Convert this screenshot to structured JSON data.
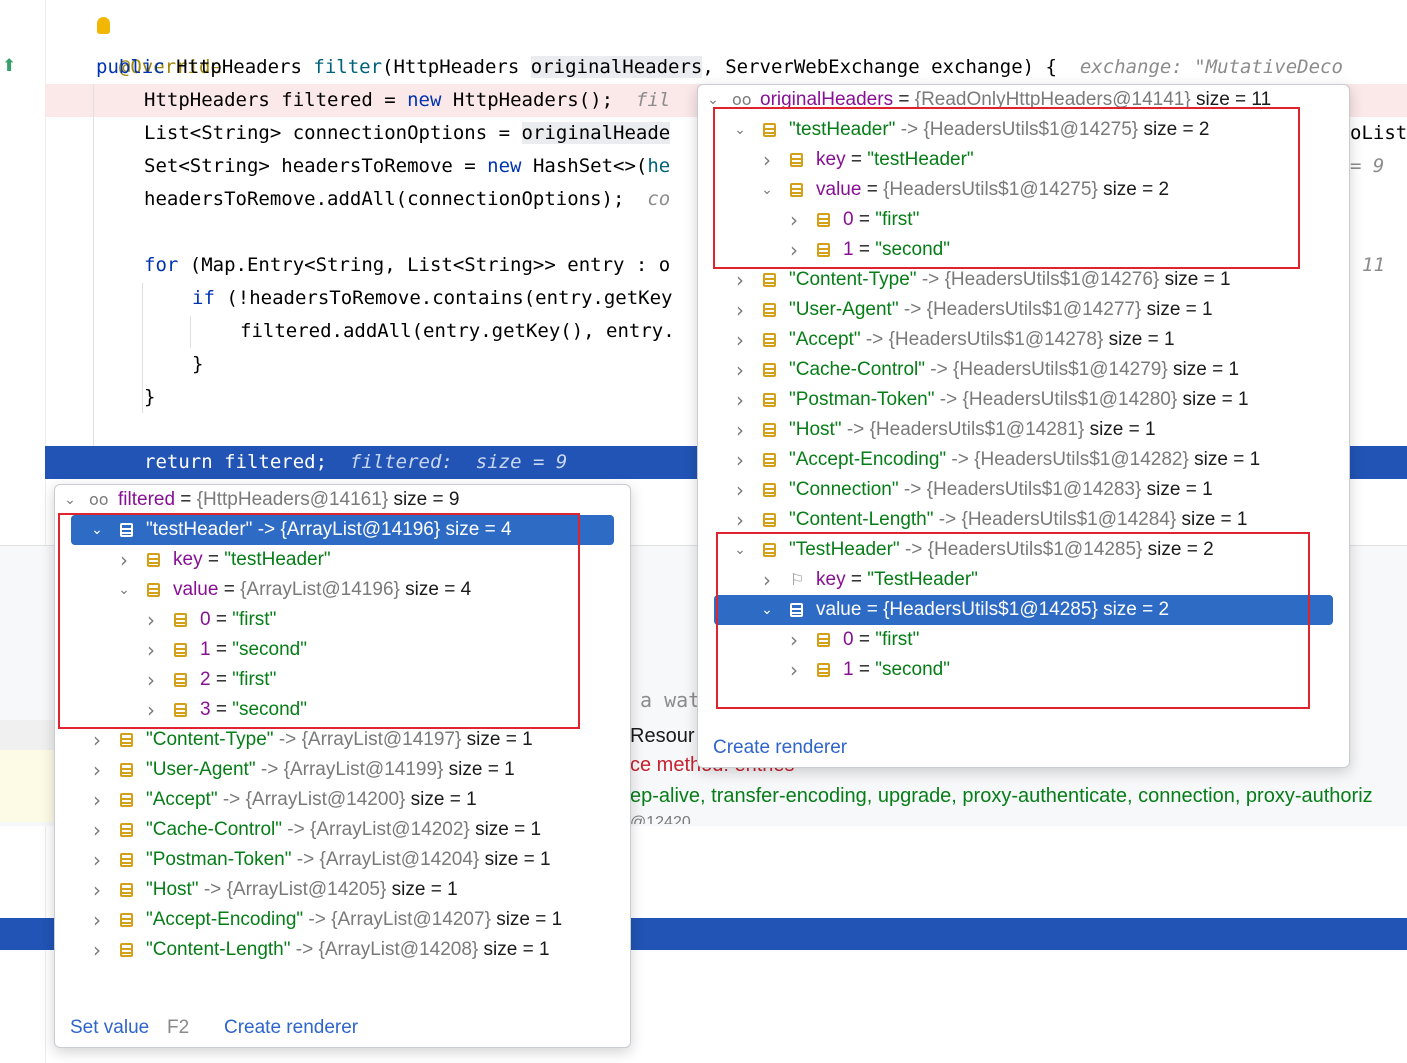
{
  "editor": {
    "annotation": "@Override",
    "signature": {
      "kw": "public",
      "type": "HttpHeaders",
      "fn": "filter",
      "p1": "(HttpHeaders ",
      "param": "originalHeaders",
      "p2": ", ServerWebExchange exchange) {",
      "hint": "exchange: \"MutativeDeco"
    },
    "l_filtered": {
      "code": "HttpHeaders filtered = ",
      "kw": "new",
      "rest": " HttpHeaders();",
      "hint": "fil"
    },
    "l_conn": {
      "code": "List<String> connectionOptions = ",
      "param": "originalHeade",
      "tail": "oList("
    },
    "l_set": {
      "code": "Set<String> headersToRemove = ",
      "kw": "new",
      "rest": " HashSet<>(",
      "rest2": "he",
      "hint": "= 9"
    },
    "l_add": {
      "code": "headersToRemove.addAll(connectionOptions);",
      "hint": "co"
    },
    "l_for": {
      "kw": "for",
      "rest": " (Map.Entry<String, List<String>> entry : o",
      "hint": "11"
    },
    "l_if": {
      "kw": "if",
      "rest": " (!headersToRemove.contains(entry.getKey"
    },
    "l_addall": {
      "code": "filtered.addAll(entry.getKey(), entry."
    },
    "l_close1": "}",
    "l_close2": "}",
    "l_return": {
      "code": "return filtered;",
      "hint": "filtered:  size = 9"
    },
    "bg_watch": "a wat",
    "bg_resou": "Resour",
    "bg_method": "ce method: entries",
    "bg_keepalive": "ep-alive, transfer-encoding, upgrade, proxy-authenticate, connection, proxy-authoriz",
    "bg_small": "@12420"
  },
  "popup_left": {
    "header": {
      "name": "filtered",
      "ref": "{HttpHeaders@14161}",
      "size": "size = 9"
    },
    "rows": [
      {
        "label": "\"testHeader\"",
        "arrow": "->",
        "ref": "{ArrayList@14196}",
        "size": "size = 4"
      },
      {
        "name": "key",
        "eq": " = ",
        "val": "\"testHeader\""
      },
      {
        "name": "value",
        "eq": " = ",
        "ref": "{ArrayList@14196}",
        "size": "size = 4"
      },
      {
        "name": "0",
        "eq": " = ",
        "val": "\"first\""
      },
      {
        "name": "1",
        "eq": " = ",
        "val": "\"second\""
      },
      {
        "name": "2",
        "eq": " = ",
        "val": "\"first\""
      },
      {
        "name": "3",
        "eq": " = ",
        "val": "\"second\""
      },
      {
        "label": "\"Content-Type\"",
        "arrow": "->",
        "ref": "{ArrayList@14197}",
        "size": "size = 1"
      },
      {
        "label": "\"User-Agent\"",
        "arrow": "->",
        "ref": "{ArrayList@14199}",
        "size": "size = 1"
      },
      {
        "label": "\"Accept\"",
        "arrow": "->",
        "ref": "{ArrayList@14200}",
        "size": "size = 1"
      },
      {
        "label": "\"Cache-Control\"",
        "arrow": "->",
        "ref": "{ArrayList@14202}",
        "size": "size = 1"
      },
      {
        "label": "\"Postman-Token\"",
        "arrow": "->",
        "ref": "{ArrayList@14204}",
        "size": "size = 1"
      },
      {
        "label": "\"Host\"",
        "arrow": "->",
        "ref": "{ArrayList@14205}",
        "size": "size = 1"
      },
      {
        "label": "\"Accept-Encoding\"",
        "arrow": "->",
        "ref": "{ArrayList@14207}",
        "size": "size = 1"
      },
      {
        "label": "\"Content-Length\"",
        "arrow": "->",
        "ref": "{ArrayList@14208}",
        "size": "size = 1"
      }
    ],
    "footer": {
      "set_value": "Set value",
      "shortcut": "F2",
      "create_renderer": "Create renderer"
    }
  },
  "popup_right": {
    "header": {
      "name": "originalHeaders",
      "ref": "{ReadOnlyHttpHeaders@14141}",
      "size": "size = 11"
    },
    "rows": [
      {
        "label": "\"testHeader\"",
        "arrow": "->",
        "ref": "{HeadersUtils$1@14275}",
        "size": "size = 2"
      },
      {
        "name": "key",
        "eq": " = ",
        "val": "\"testHeader\""
      },
      {
        "name": "value",
        "eq": " = ",
        "ref": "{HeadersUtils$1@14275}",
        "size": "size = 2"
      },
      {
        "name": "0",
        "eq": " = ",
        "val": "\"first\""
      },
      {
        "name": "1",
        "eq": " = ",
        "val": "\"second\""
      },
      {
        "label": "\"Content-Type\"",
        "arrow": "->",
        "ref": "{HeadersUtils$1@14276}",
        "size": "size = 1"
      },
      {
        "label": "\"User-Agent\"",
        "arrow": "->",
        "ref": "{HeadersUtils$1@14277}",
        "size": "size = 1"
      },
      {
        "label": "\"Accept\"",
        "arrow": "->",
        "ref": "{HeadersUtils$1@14278}",
        "size": "size = 1"
      },
      {
        "label": "\"Cache-Control\"",
        "arrow": "->",
        "ref": "{HeadersUtils$1@14279}",
        "size": "size = 1"
      },
      {
        "label": "\"Postman-Token\"",
        "arrow": "->",
        "ref": "{HeadersUtils$1@14280}",
        "size": "size = 1"
      },
      {
        "label": "\"Host\"",
        "arrow": "->",
        "ref": "{HeadersUtils$1@14281}",
        "size": "size = 1"
      },
      {
        "label": "\"Accept-Encoding\"",
        "arrow": "->",
        "ref": "{HeadersUtils$1@14282}",
        "size": "size = 1"
      },
      {
        "label": "\"Connection\"",
        "arrow": "->",
        "ref": "{HeadersUtils$1@14283}",
        "size": "size = 1"
      },
      {
        "label": "\"Content-Length\"",
        "arrow": "->",
        "ref": "{HeadersUtils$1@14284}",
        "size": "size = 1"
      },
      {
        "label": "\"TestHeader\"",
        "arrow": "->",
        "ref": "{HeadersUtils$1@14285}",
        "size": "size = 2"
      },
      {
        "name": "key",
        "eq": " = ",
        "val": "\"TestHeader\""
      },
      {
        "name": "value",
        "eq": " = ",
        "ref": "{HeadersUtils$1@14285}",
        "size": "size = 2"
      },
      {
        "name": "0",
        "eq": " = ",
        "val": "\"first\""
      },
      {
        "name": "1",
        "eq": " = ",
        "val": "\"second\""
      }
    ],
    "footer": {
      "create_renderer": "Create renderer"
    }
  }
}
